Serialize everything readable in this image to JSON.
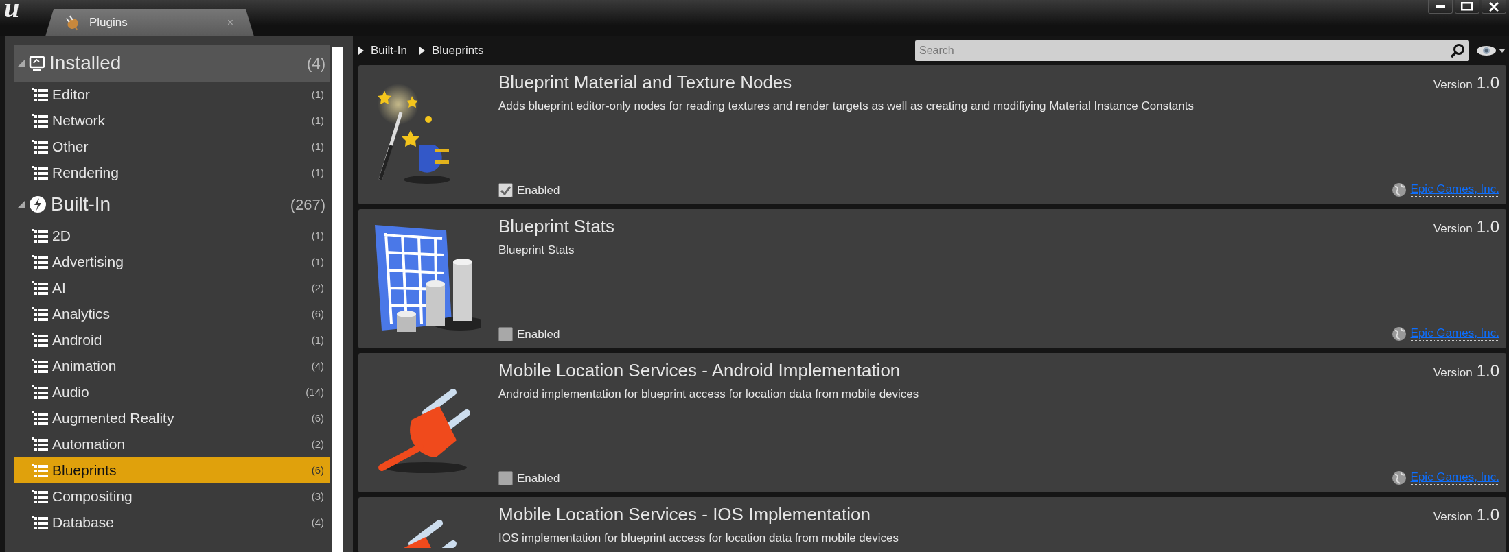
{
  "app_logo": "u",
  "tab": {
    "label": "Plugins",
    "close": "×"
  },
  "sidebar": {
    "sections": [
      {
        "label": "Installed",
        "count": "(4)",
        "expanded": true,
        "highlighted": true,
        "children": [
          {
            "label": "Editor",
            "count": "(1)",
            "selected": false
          },
          {
            "label": "Network",
            "count": "(1)",
            "selected": false
          },
          {
            "label": "Other",
            "count": "(1)",
            "selected": false
          },
          {
            "label": "Rendering",
            "count": "(1)",
            "selected": false
          }
        ]
      },
      {
        "label": "Built-In",
        "count": "(267)",
        "expanded": true,
        "highlighted": false,
        "children": [
          {
            "label": "2D",
            "count": "(1)",
            "selected": false
          },
          {
            "label": "Advertising",
            "count": "(1)",
            "selected": false
          },
          {
            "label": "AI",
            "count": "(2)",
            "selected": false
          },
          {
            "label": "Analytics",
            "count": "(6)",
            "selected": false
          },
          {
            "label": "Android",
            "count": "(1)",
            "selected": false
          },
          {
            "label": "Animation",
            "count": "(4)",
            "selected": false
          },
          {
            "label": "Audio",
            "count": "(14)",
            "selected": false
          },
          {
            "label": "Augmented Reality",
            "count": "(6)",
            "selected": false
          },
          {
            "label": "Automation",
            "count": "(2)",
            "selected": false
          },
          {
            "label": "Blueprints",
            "count": "(6)",
            "selected": true
          },
          {
            "label": "Compositing",
            "count": "(3)",
            "selected": false
          },
          {
            "label": "Database",
            "count": "(4)",
            "selected": false
          }
        ]
      }
    ]
  },
  "breadcrumb": [
    "Built-In",
    "Blueprints"
  ],
  "search": {
    "placeholder": "Search"
  },
  "plugins": [
    {
      "title": "Blueprint Material and Texture Nodes",
      "description": "Adds blueprint editor-only nodes for reading textures and render targets as well as creating and modifiying Material Instance Constants",
      "enabled": true,
      "enabled_label": "Enabled",
      "version_label": "Version",
      "version": "1.0",
      "vendor": "Epic Games, Inc."
    },
    {
      "title": "Blueprint Stats",
      "description": "Blueprint Stats",
      "enabled": false,
      "enabled_label": "Enabled",
      "version_label": "Version",
      "version": "1.0",
      "vendor": "Epic Games, Inc."
    },
    {
      "title": "Mobile Location Services - Android Implementation",
      "description": "Android implementation for blueprint access for location data from mobile devices",
      "enabled": false,
      "enabled_label": "Enabled",
      "version_label": "Version",
      "version": "1.0",
      "vendor": "Epic Games, Inc."
    },
    {
      "title": "Mobile Location Services - IOS Implementation",
      "description": "IOS implementation for blueprint access for location data from mobile devices",
      "version_label": "Version",
      "version": "1.0"
    }
  ]
}
